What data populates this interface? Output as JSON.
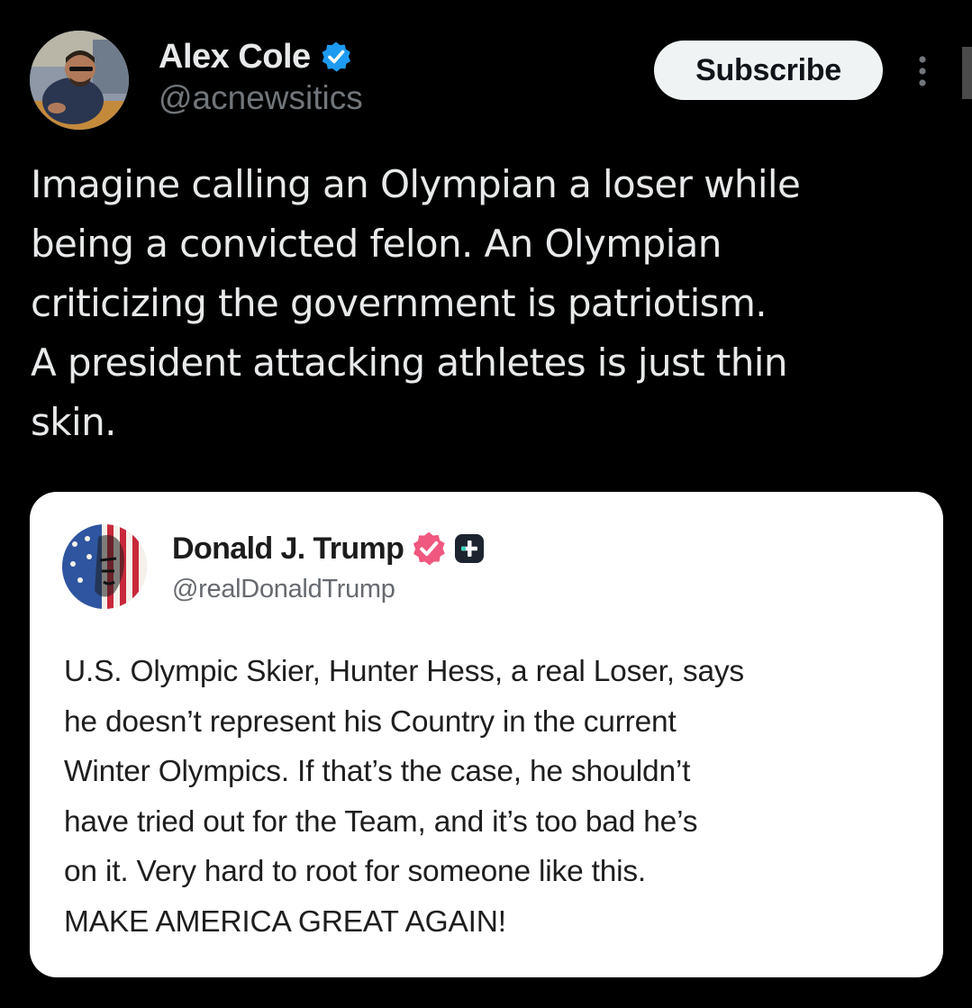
{
  "post": {
    "author": {
      "name": "Alex Cole",
      "handle": "@acnewsitics",
      "verified": true,
      "verified_color": "#1d9bf0",
      "avatar_icon": "profile-photo"
    },
    "subscribe_label": "Subscribe",
    "more_icon": "more-vertical-icon",
    "text": "Imagine calling an Olympian a loser while\nbeing a convicted felon. An Olympian\ncriticizing the government is patriotism.\nA president attacking athletes is just thin\nskin."
  },
  "quote": {
    "author": {
      "name": "Donald J. Trump",
      "handle": "@realDonaldTrump",
      "verified": true,
      "verified_color": "#f0587f",
      "avatar_icon": "american-flag-portrait"
    },
    "text": "U.S. Olympic Skier, Hunter Hess, a real Loser, says\nhe doesn’t represent his Country in the current\nWinter Olympics. If that’s the case, he shouldn’t\nhave tried out for the Team, and it’s too bad he’s\non it. Very hard to root for someone like this.\nMAKE AMERICA GREAT AGAIN!"
  },
  "colors": {
    "background": "#000000",
    "text_primary": "#e7e9ea",
    "text_secondary": "#71767b",
    "card_background": "#ffffff"
  }
}
